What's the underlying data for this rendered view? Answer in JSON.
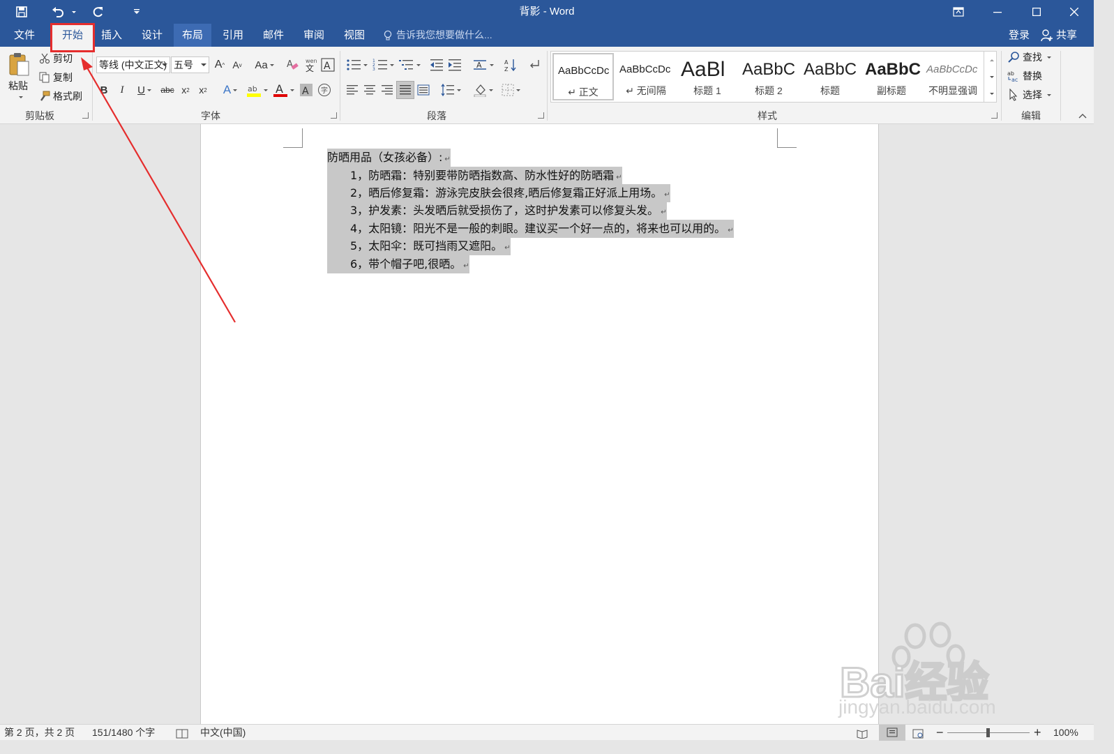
{
  "window": {
    "title": "背影 - Word"
  },
  "menu_tabs": [
    {
      "label": "文件"
    },
    {
      "label": "开始"
    },
    {
      "label": "插入"
    },
    {
      "label": "设计"
    },
    {
      "label": "布局"
    },
    {
      "label": "引用"
    },
    {
      "label": "邮件"
    },
    {
      "label": "审阅"
    },
    {
      "label": "视图"
    }
  ],
  "tell_me": "告诉我您想要做什么...",
  "account": {
    "login": "登录",
    "share": "共享"
  },
  "clipboard": {
    "paste": "粘贴",
    "cut": "剪切",
    "copy": "复制",
    "format_painter": "格式刷",
    "label": "剪贴板"
  },
  "font": {
    "font_name": "等线 (中文正文)",
    "font_size": "五号",
    "label": "字体"
  },
  "paragraph": {
    "label": "段落"
  },
  "styles": {
    "label": "样式",
    "items": [
      {
        "sample": "AaBbCcDc",
        "name": "↵ 正文"
      },
      {
        "sample": "AaBbCcDc",
        "name": "↵ 无间隔"
      },
      {
        "sample": "AaBl",
        "name": "标题 1"
      },
      {
        "sample": "AaBbC",
        "name": "标题 2"
      },
      {
        "sample": "AaBbC",
        "name": "标题"
      },
      {
        "sample": "AaBbC",
        "name": "副标题"
      },
      {
        "sample": "AaBbCcDc",
        "name": "不明显强调"
      }
    ]
  },
  "editing": {
    "find": "查找",
    "replace": "替换",
    "select": "选择",
    "label": "编辑"
  },
  "document": {
    "lines": [
      "防晒用品（女孩必备）:",
      "1，防晒霜：特别要带防晒指数高、防水性好的防晒霜",
      "2，晒后修复霜：游泳完皮肤会很疼,晒后修复霜正好派上用场。",
      "3，护发素：头发晒后就受损伤了，这时护发素可以修复头发。",
      "4，太阳镜：阳光不是一般的刺眼。建议买一个好一点的，将来也可以用的。",
      "5，太阳伞：既可挡雨又遮阳。",
      "6，带个帽子吧,很晒。"
    ]
  },
  "status": {
    "page": "第 2 页，共 2 页",
    "words": "151/1480 个字",
    "language": "中文(中国)",
    "zoom": "100%"
  },
  "watermark": {
    "brand": "Bai经验",
    "url": "jingyan.baidu.com"
  },
  "colors": {
    "brand": "#2b579a",
    "highlight": "#e52d2d",
    "selection": "#c8c8c8"
  }
}
